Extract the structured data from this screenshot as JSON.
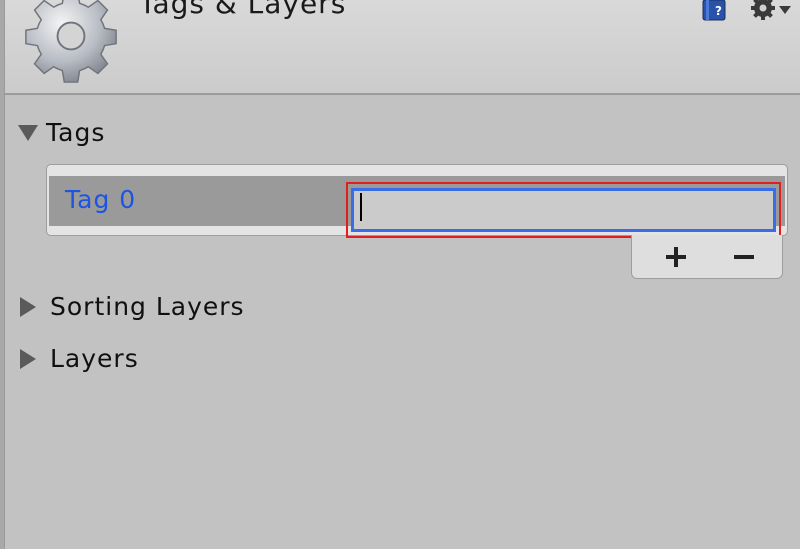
{
  "header": {
    "title": "Tags & Layers",
    "icon": "gear-icon",
    "help_icon": "help-book-icon",
    "settings_icon": "gear-dropdown-icon"
  },
  "sections": {
    "tags": {
      "label": "Tags",
      "expanded": true,
      "items": [
        {
          "label": "Tag 0",
          "value": ""
        }
      ],
      "add_label": "+",
      "remove_label": "−"
    },
    "sorting_layers": {
      "label": "Sorting Layers",
      "expanded": false
    },
    "layers": {
      "label": "Layers",
      "expanded": false
    }
  },
  "colors": {
    "tag_label": "#1c54e4",
    "focus_border": "#3b6ce8",
    "highlight_box": "#e0201e"
  }
}
